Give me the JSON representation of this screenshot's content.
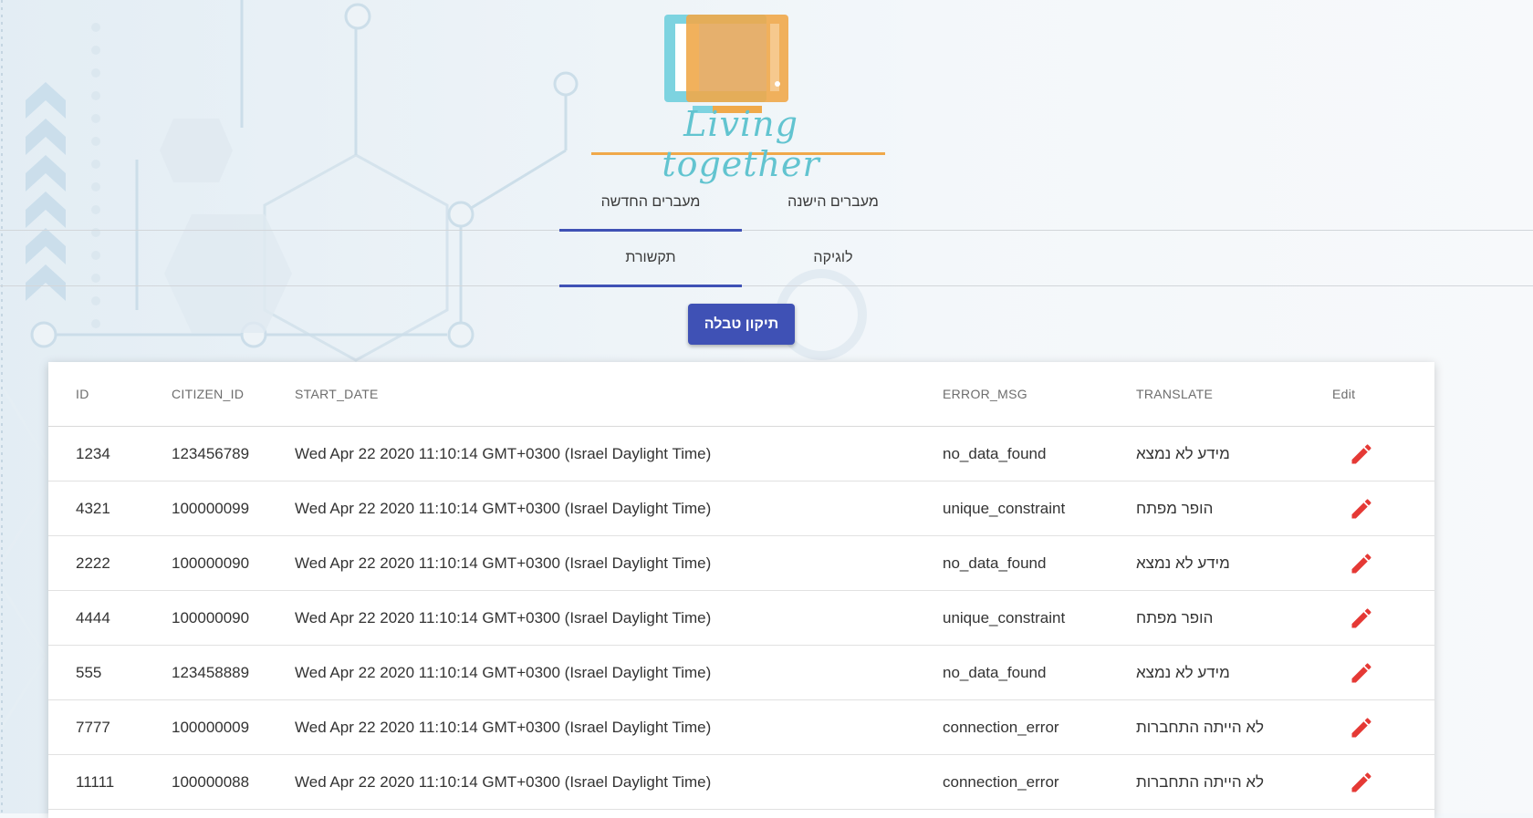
{
  "logo": {
    "text": "Living together"
  },
  "tabs_row1": [
    {
      "label": "מעברים החדשה",
      "active": true
    },
    {
      "label": "מעברים הישנה",
      "active": false
    }
  ],
  "tabs_row2": [
    {
      "label": "תקשורת",
      "active": true
    },
    {
      "label": "לוגיקה",
      "active": false
    }
  ],
  "fix_button": {
    "label": "תיקון טבלה"
  },
  "table": {
    "headers": {
      "id": "ID",
      "citizen_id": "CITIZEN_ID",
      "start_date": "START_DATE",
      "error_msg": "ERROR_MSG",
      "translate": "TRANSLATE",
      "edit": "Edit"
    },
    "rows": [
      {
        "id": "1234",
        "citizen_id": "123456789",
        "start_date": "Wed Apr 22 2020 11:10:14 GMT+0300 (Israel Daylight Time)",
        "error_msg": "no_data_found",
        "translate": "מידע לא נמצא"
      },
      {
        "id": "4321",
        "citizen_id": "100000099",
        "start_date": "Wed Apr 22 2020 11:10:14 GMT+0300 (Israel Daylight Time)",
        "error_msg": "unique_constraint",
        "translate": "הופר מפתח"
      },
      {
        "id": "2222",
        "citizen_id": "100000090",
        "start_date": "Wed Apr 22 2020 11:10:14 GMT+0300 (Israel Daylight Time)",
        "error_msg": "no_data_found",
        "translate": "מידע לא נמצא"
      },
      {
        "id": "4444",
        "citizen_id": "100000090",
        "start_date": "Wed Apr 22 2020 11:10:14 GMT+0300 (Israel Daylight Time)",
        "error_msg": "unique_constraint",
        "translate": "הופר מפתח"
      },
      {
        "id": "555",
        "citizen_id": "123458889",
        "start_date": "Wed Apr 22 2020 11:10:14 GMT+0300 (Israel Daylight Time)",
        "error_msg": "no_data_found",
        "translate": "מידע לא נמצא"
      },
      {
        "id": "7777",
        "citizen_id": "100000009",
        "start_date": "Wed Apr 22 2020 11:10:14 GMT+0300 (Israel Daylight Time)",
        "error_msg": "connection_error",
        "translate": "לא הייתה התחברות"
      },
      {
        "id": "11111",
        "citizen_id": "100000088",
        "start_date": "Wed Apr 22 2020 11:10:14 GMT+0300 (Israel Daylight Time)",
        "error_msg": "connection_error",
        "translate": "לא הייתה התחברות"
      }
    ]
  },
  "colors": {
    "accent": "#3f51b5",
    "edit_icon": "#e53935",
    "logo_cyan": "#62c4d0",
    "logo_orange": "#f0a94a"
  },
  "icons": {
    "edit": "pencil-icon"
  }
}
